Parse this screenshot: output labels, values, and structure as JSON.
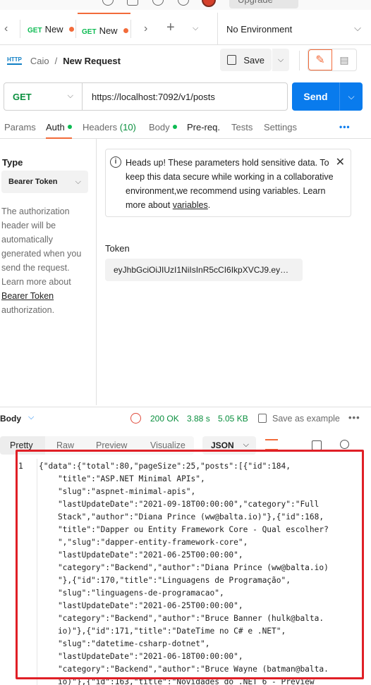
{
  "top": {
    "upgrade_label": "Upgrade"
  },
  "tabs": [
    {
      "method": "GET",
      "label": "New"
    },
    {
      "method": "GET",
      "label": "New"
    }
  ],
  "environment": {
    "selected": "No Environment"
  },
  "breadcrumb": {
    "workspace": "Caio",
    "separator": "/",
    "request_name": "New Request",
    "http_badge": "HTTP"
  },
  "toolbar": {
    "save_label": "Save"
  },
  "request": {
    "method": "GET",
    "url": "https://localhost:7092/v1/posts",
    "send_label": "Send"
  },
  "request_tabs": [
    {
      "label": "Params"
    },
    {
      "label": "Auth"
    },
    {
      "label": "Headers",
      "count": "(10)"
    },
    {
      "label": "Body"
    },
    {
      "label": "Pre-req."
    },
    {
      "label": "Tests"
    },
    {
      "label": "Settings"
    }
  ],
  "auth": {
    "type_label": "Type",
    "type_value": "Bearer Token",
    "description_pre": "The authorization header will be automatically generated when you send the request. Learn more about ",
    "description_link": "Bearer Token",
    "description_post": " authorization.",
    "notice_pre": "Heads up! These parameters hold sensitive data. To keep this data secure while working in a collaborative environment,we recommend using variables. Learn more about ",
    "notice_link": "variables",
    "notice_post": ".",
    "token_label": "Token",
    "token_value": "eyJhbGciOiJIUzI1NiIsInR5cCI6IkpXVCJ9.ey…"
  },
  "response": {
    "label": "Body",
    "status": "200 OK",
    "time": "3.88 s",
    "size": "5.05 KB",
    "save_example_label": "Save as example",
    "view_tabs": [
      "Pretty",
      "Raw",
      "Preview",
      "Visualize"
    ],
    "format": "JSON",
    "line_number": "1",
    "code_lines": [
      "{\"data\":{\"total\":80,\"pageSize\":25,\"posts\":[{\"id\":184,",
      "    \"title\":\"ASP.NET Minimal APIs\",",
      "    \"slug\":\"aspnet-minimal-apis\",",
      "    \"lastUpdateDate\":\"2021-09-18T00:00:00\",\"category\":\"Full",
      "    Stack\",\"author\":\"Diana Prince (ww@balta.io)\"},{\"id\":168,",
      "    \"title\":\"Dapper ou Entity Framework Core - Qual escolher?",
      "    \",\"slug\":\"dapper-entity-framework-core\",",
      "    \"lastUpdateDate\":\"2021-06-25T00:00:00\",",
      "    \"category\":\"Backend\",\"author\":\"Diana Prince (ww@balta.io)",
      "    \"},{\"id\":170,\"title\":\"Linguagens de Programação\",",
      "    \"slug\":\"linguagens-de-programacao\",",
      "    \"lastUpdateDate\":\"2021-06-25T00:00:00\",",
      "    \"category\":\"Backend\",\"author\":\"Bruce Banner (hulk@balta.",
      "    io)\"},{\"id\":171,\"title\":\"DateTime no C# e .NET\",",
      "    \"slug\":\"datetime-csharp-dotnet\",",
      "    \"lastUpdateDate\":\"2021-06-18T00:00:00\",",
      "    \"category\":\"Backend\",\"author\":\"Bruce Wayne (batman@balta.",
      "    io)\"},{\"id\":163,\"title\":\"Novidades do .NET 6 - Preview"
    ]
  },
  "colors": {
    "accent": "#f26b3a",
    "send": "#097bed",
    "ok": "#0a8f3e",
    "highlight": "#e01f26"
  }
}
